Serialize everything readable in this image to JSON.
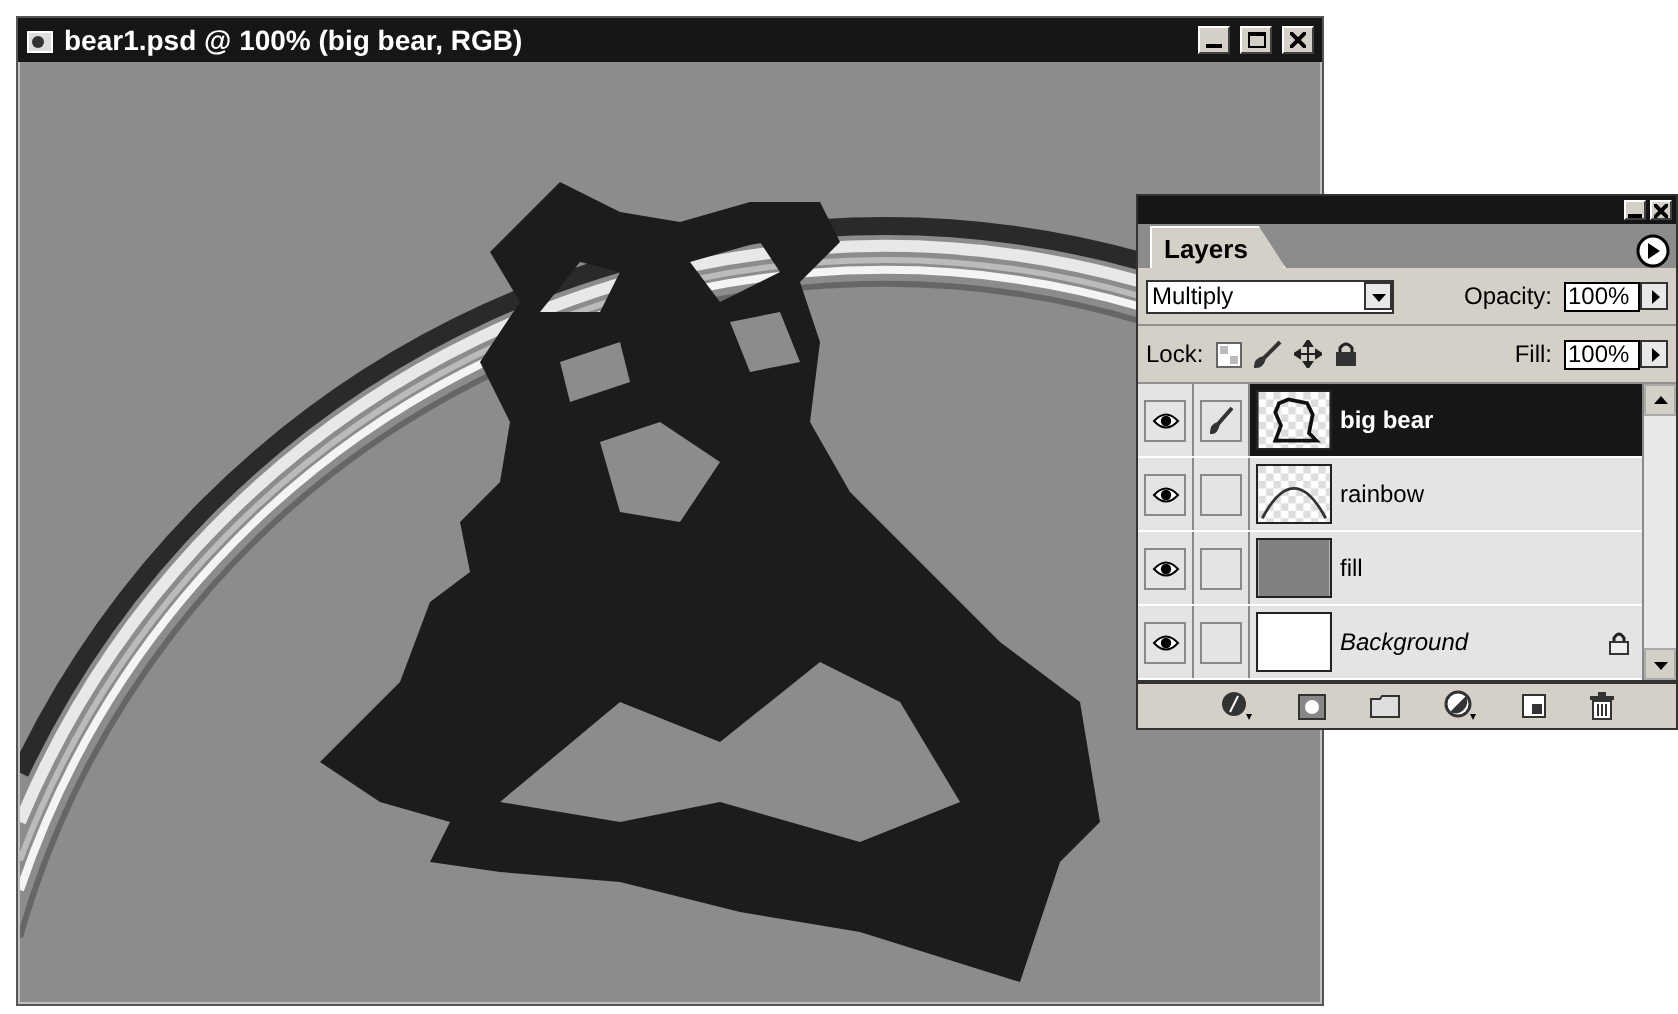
{
  "window": {
    "title": "bear1.psd @ 100% (big bear, RGB)"
  },
  "layers_palette": {
    "tab": "Layers",
    "blend_mode": "Multiply",
    "opacity_label": "Opacity:",
    "opacity": "100%",
    "lock_label": "Lock:",
    "fill_label": "Fill:",
    "fill": "100%",
    "layers": [
      {
        "name": "big bear",
        "kind": "bear",
        "selected": true,
        "visible": true,
        "editing": true,
        "locked": false
      },
      {
        "name": "rainbow",
        "kind": "rainbow",
        "selected": false,
        "visible": true,
        "editing": false,
        "locked": false
      },
      {
        "name": "fill",
        "kind": "fill",
        "selected": false,
        "visible": true,
        "editing": false,
        "locked": false
      },
      {
        "name": "Background",
        "kind": "background",
        "selected": false,
        "visible": true,
        "editing": false,
        "locked": true
      }
    ]
  }
}
